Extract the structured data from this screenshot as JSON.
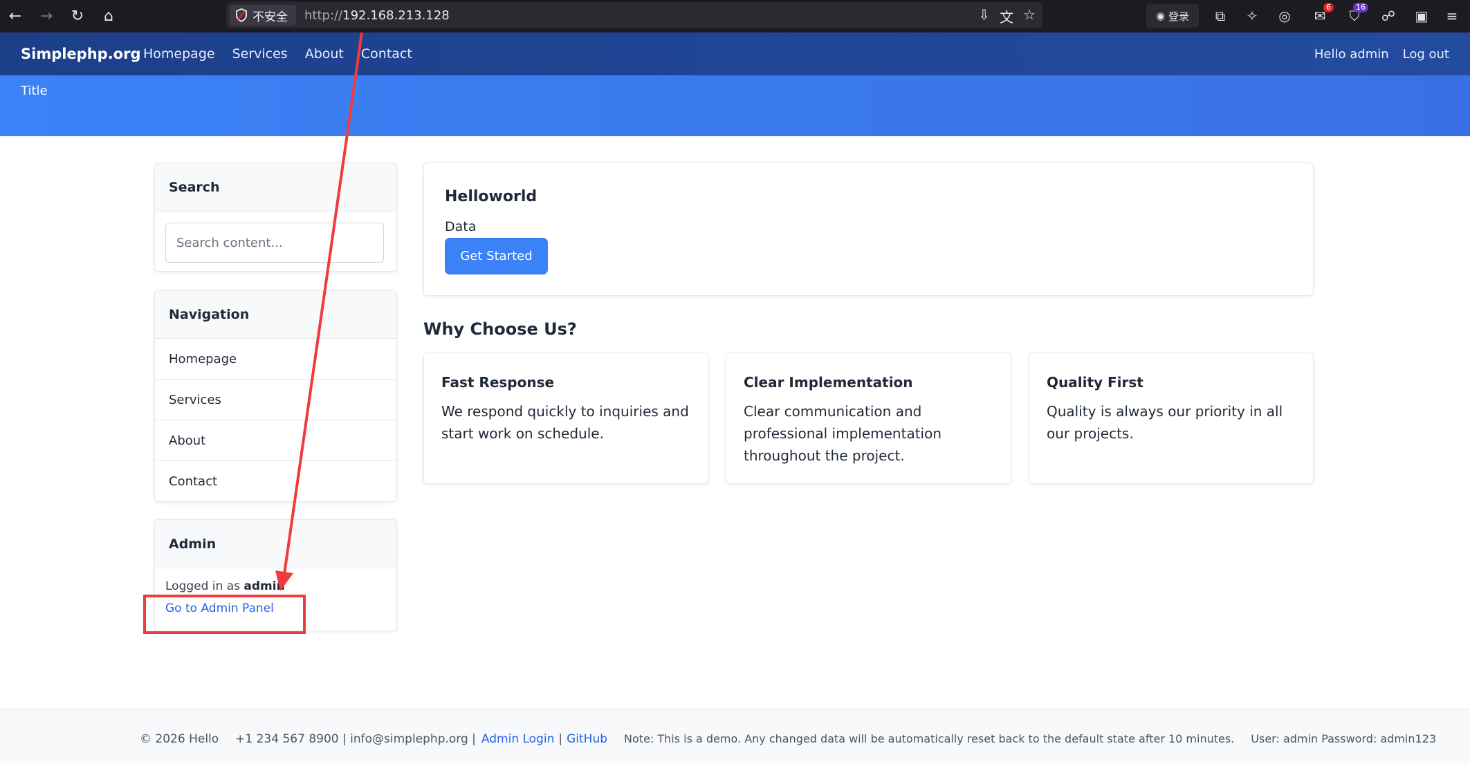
{
  "browser": {
    "security_label": "不安全",
    "url_prefix": "http://",
    "url_host": "192.168.213.128",
    "login_label": "登录",
    "ext_badge_1": "6",
    "ext_badge_2": "16"
  },
  "site": {
    "brand": "Simplephp.org",
    "menu": [
      "Homepage",
      "Services",
      "About",
      "Contact"
    ],
    "greeting": "Hello admin",
    "logout": "Log out",
    "hero_title": "Title"
  },
  "sidebar": {
    "search_title": "Search",
    "search_placeholder": "Search content...",
    "nav_title": "Navigation",
    "nav_items": [
      "Homepage",
      "Services",
      "About",
      "Contact"
    ],
    "admin_title": "Admin",
    "logged_in_prefix": "Logged in as",
    "logged_in_user": "admin",
    "admin_link": "Go to Admin Panel"
  },
  "main": {
    "hello_title": "Helloworld",
    "hello_data": "Data",
    "cta_label": "Get Started",
    "why_title": "Why Choose Us?",
    "features": [
      {
        "title": "Fast Response",
        "text": "We respond quickly to inquiries and start work on schedule."
      },
      {
        "title": "Clear Implementation",
        "text": "Clear communication and professional implementation throughout the project."
      },
      {
        "title": "Quality First",
        "text": "Quality is always our priority in all our projects."
      }
    ]
  },
  "footer": {
    "copyright": "© 2026 Hello",
    "contact": "+1 234 567 8900 | info@simplephp.org |",
    "admin_login": "Admin Login",
    "separator": "|",
    "github": "GitHub",
    "note": "Note: This is a demo. Any changed data will be automatically reset back to the default state after 10 minutes.",
    "credentials": "User: admin Password: admin123"
  },
  "colors": {
    "nav_bg": "#1d3f8a",
    "hero_bg": "#3b82f6",
    "accent": "#3b82f6",
    "annotation": "#ef3b3b"
  }
}
